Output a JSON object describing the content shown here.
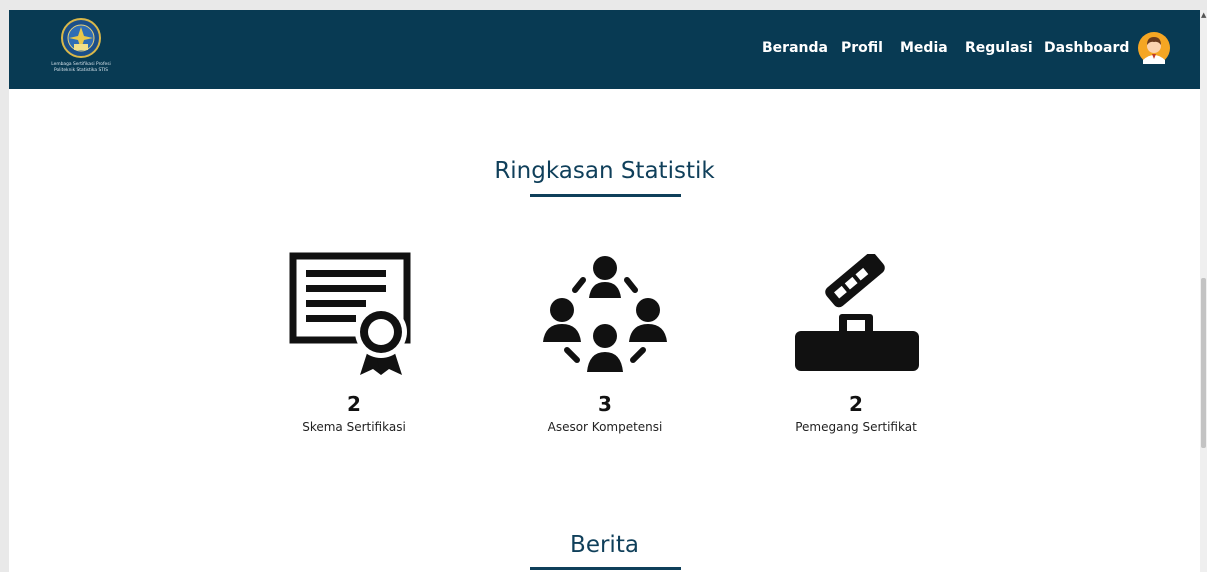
{
  "brand": {
    "logo_line1": "Lembaga Sertifikasi Profesi",
    "logo_line2": "Politeknik Statistika STIS"
  },
  "nav": {
    "items": [
      {
        "label": "Beranda"
      },
      {
        "label": "Profil"
      },
      {
        "label": "Media"
      },
      {
        "label": "Regulasi"
      },
      {
        "label": "Dashboard"
      }
    ],
    "avatar_icon": "user-avatar-icon"
  },
  "stats_section": {
    "title": "Ringkasan Statistik",
    "items": [
      {
        "icon": "certificate-icon",
        "number": "2",
        "label": "Skema Sertifikasi"
      },
      {
        "icon": "people-circle-icon",
        "number": "3",
        "label": "Asesor Kompetensi"
      },
      {
        "icon": "handshake-podium-icon",
        "number": "2",
        "label": "Pemegang Sertifikat"
      }
    ]
  },
  "news_section": {
    "title": "Berita"
  },
  "colors": {
    "navbar": "#083a53",
    "accent": "#0f3f5a",
    "background": "#ffffff"
  }
}
